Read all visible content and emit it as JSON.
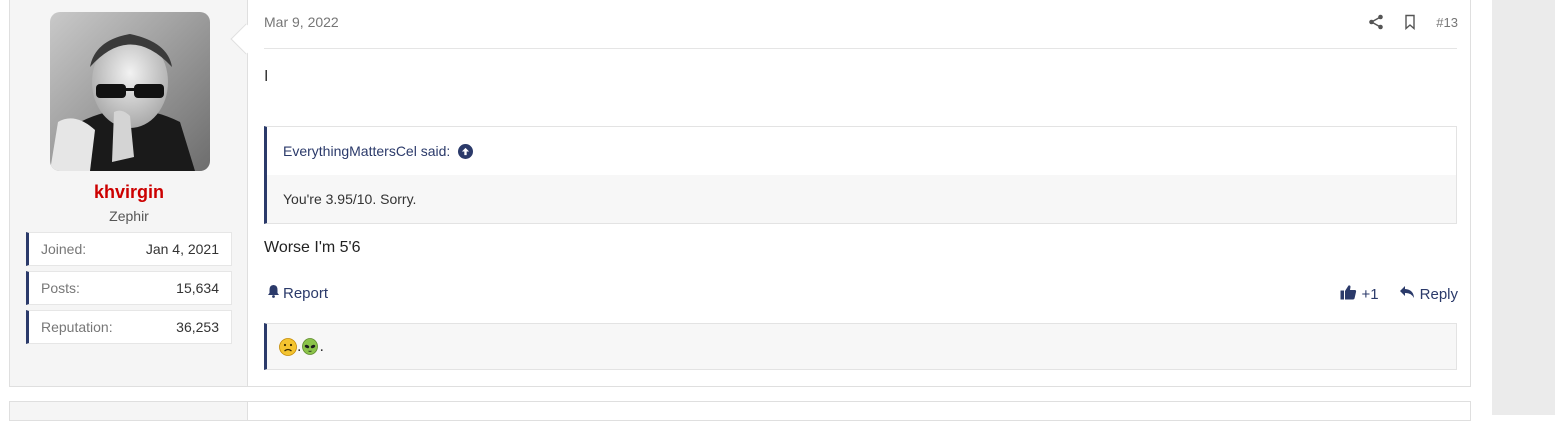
{
  "post": {
    "user": {
      "username": "khvirgin",
      "title": "Zephir",
      "stats": [
        {
          "label": "Joined:",
          "value": "Jan 4, 2021"
        },
        {
          "label": "Posts:",
          "value": "15,634"
        },
        {
          "label": "Reputation:",
          "value": "36,253"
        }
      ]
    },
    "date": "Mar 9, 2022",
    "post_number": "#13",
    "first_line": "I",
    "quote": {
      "author_said": "EverythingMattersCel said:",
      "text": "You're 3.95/10. Sorry."
    },
    "reply_text": "Worse I'm 5'6",
    "actions": {
      "report_label": "Report",
      "reaction_count": "+1",
      "reply_label": "Reply"
    },
    "signature": {
      "text": ".",
      "text_end": ".",
      "emojis": [
        "frowning-face-emoji",
        "alien-emoji"
      ]
    }
  },
  "colors": {
    "accent": "#2b3a6a",
    "username": "#cc0000"
  }
}
